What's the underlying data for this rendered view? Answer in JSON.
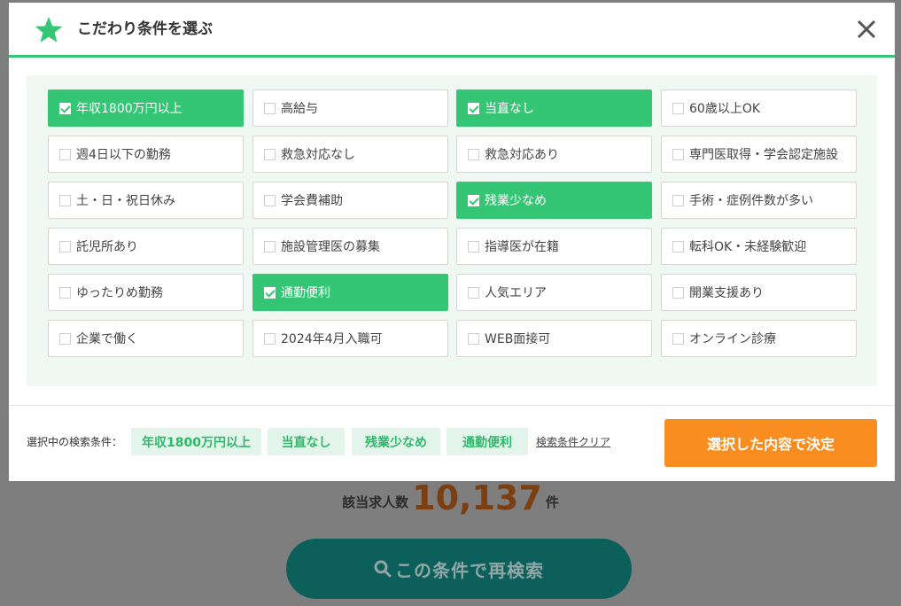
{
  "modal": {
    "title": "こだわり条件を選ぶ",
    "star_icon": "star-icon",
    "close_icon": "close-icon",
    "options": [
      {
        "label": "年収1800万円以上",
        "checked": true
      },
      {
        "label": "高給与",
        "checked": false
      },
      {
        "label": "当直なし",
        "checked": true
      },
      {
        "label": "60歳以上OK",
        "checked": false
      },
      {
        "label": "週4日以下の勤務",
        "checked": false
      },
      {
        "label": "救急対応なし",
        "checked": false
      },
      {
        "label": "救急対応あり",
        "checked": false
      },
      {
        "label": "専門医取得・学会認定施設",
        "checked": false
      },
      {
        "label": "土・日・祝日休み",
        "checked": false
      },
      {
        "label": "学会費補助",
        "checked": false
      },
      {
        "label": "残業少なめ",
        "checked": true
      },
      {
        "label": "手術・症例件数が多い",
        "checked": false
      },
      {
        "label": "託児所あり",
        "checked": false
      },
      {
        "label": "施設管理医の募集",
        "checked": false
      },
      {
        "label": "指導医が在籍",
        "checked": false
      },
      {
        "label": "転科OK・未経験歓迎",
        "checked": false
      },
      {
        "label": "ゆったりめ勤務",
        "checked": false
      },
      {
        "label": "通勤便利",
        "checked": true
      },
      {
        "label": "人気エリア",
        "checked": false
      },
      {
        "label": "開業支援あり",
        "checked": false
      },
      {
        "label": "企業で働く",
        "checked": false
      },
      {
        "label": "2024年4月入職可",
        "checked": false
      },
      {
        "label": "WEB面接可",
        "checked": false
      },
      {
        "label": "オンライン診療",
        "checked": false
      }
    ],
    "footer": {
      "selected_label": "選択中の検索条件：",
      "selected_tags": [
        "年収1800万円以上",
        "当直なし",
        "残業少なめ",
        "通勤便利"
      ],
      "clear_label": "検索条件クリア",
      "submit_label": "選択した内容で決定"
    }
  },
  "background": {
    "count_label": "該当求人数",
    "count_value": "10,137",
    "count_unit": "件",
    "search_button_label": "この条件で再検索"
  },
  "colors": {
    "accent_green": "#34c675",
    "tag_bg": "#e3f5ea",
    "submit_orange": "#f98d1f",
    "overlay": "#7e7e7e"
  }
}
